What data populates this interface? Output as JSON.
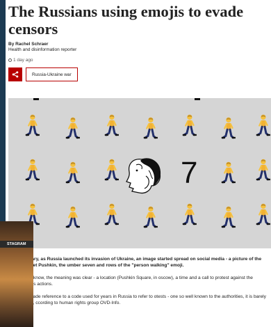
{
  "article": {
    "headline": "The Russians using emojis to evade censors",
    "author": "By Rachel Schraer",
    "author_role": "Health and disinformation reporter",
    "published": "1 day ago",
    "topic_tag": "Russia-Ukraine war"
  },
  "hero": {
    "number": "7",
    "emoji": "person-walking"
  },
  "overlay": {
    "tag": "STAGRAM"
  },
  "paragraphs": [
    "n 24 February, as Russia launched its invasion of Ukraine, an image started spread on social media - a picture of the Russian poet Pushkin, the umber seven and rows of the \"person walking\" emoji.",
    "those in the know, the meaning was clear - a location (Pushkin Square, in oscow), a time and a call to protest against the government's actions.",
    "he emojis made reference to a code used for years in Russia to refer to otests - one so well known to the authorities, it is barely a code at all, ccording to human rights group OVD-Info."
  ],
  "colors": {
    "brand_red": "#b80000",
    "side_background": "#1b3a52",
    "hero_background": "#d5d5d5"
  }
}
